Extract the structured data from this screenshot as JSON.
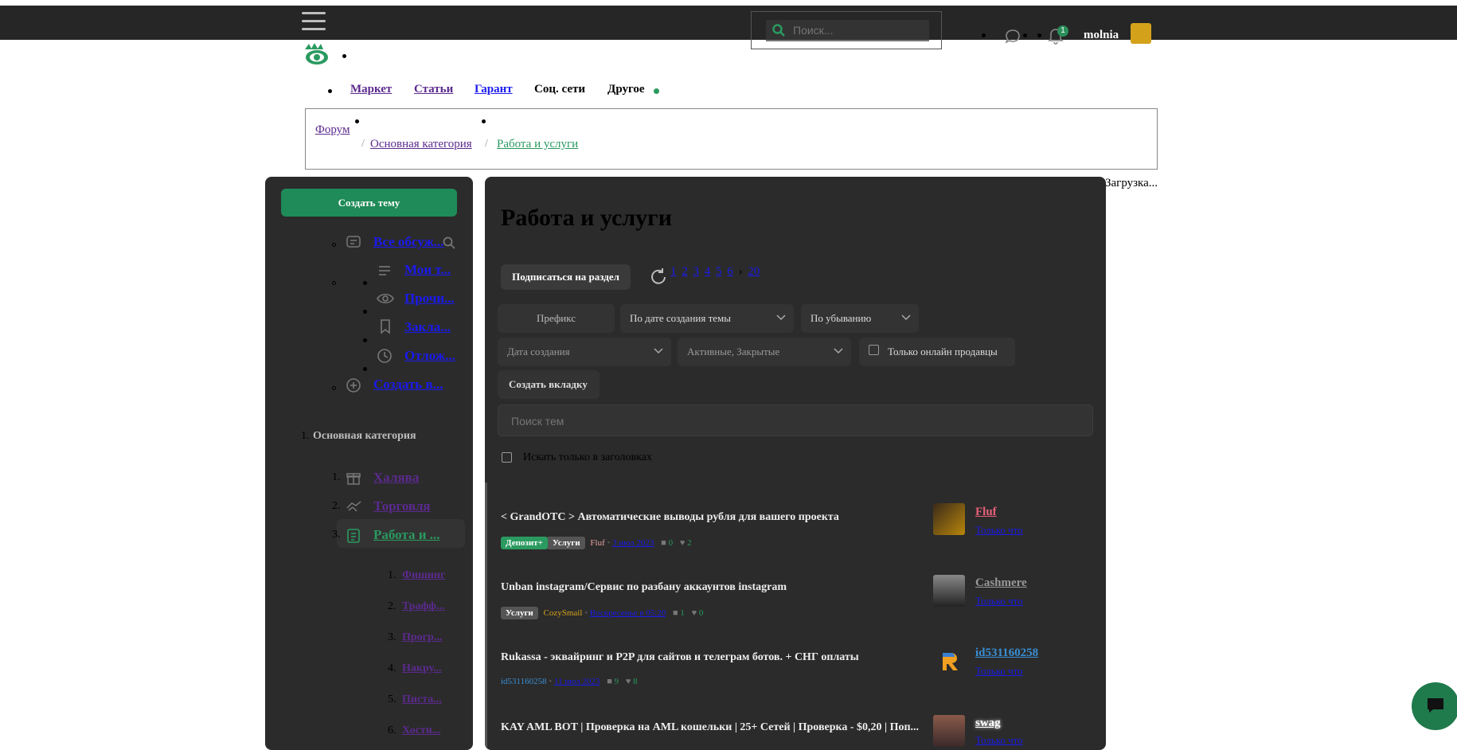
{
  "header": {
    "search_placeholder": "Поиск...",
    "notifications_count": "1",
    "username": "molnia"
  },
  "nav": {
    "items": [
      {
        "label": "Маркет"
      },
      {
        "label": "Статьи"
      },
      {
        "label": "Гарант"
      },
      {
        "label": "Соц. сети"
      },
      {
        "label": "Другое"
      }
    ]
  },
  "breadcrumb": [
    "Форум",
    "Основная категория",
    "Работа и услуги"
  ],
  "loading_text": "Загрузка...",
  "sidebar": {
    "create_button": "Создать тему",
    "links": [
      {
        "label": "Все обсуж..."
      },
      {
        "label": "Мои т..."
      },
      {
        "label": "Прочи..."
      },
      {
        "label": "Закла..."
      },
      {
        "label": "Отлож..."
      },
      {
        "label": "Создать в..."
      }
    ],
    "category_title": "Основная категория",
    "categories": [
      {
        "num": "1.",
        "label": "Халява"
      },
      {
        "num": "2.",
        "label": "Торговля"
      },
      {
        "num": "3.",
        "label": "Работа и ..."
      }
    ],
    "subcategories": [
      {
        "num": "1.",
        "label": "Фишинг"
      },
      {
        "num": "2.",
        "label": "Трафф..."
      },
      {
        "num": "3.",
        "label": "Прогр..."
      },
      {
        "num": "4.",
        "label": "Накру..."
      },
      {
        "num": "5.",
        "label": "Писта..."
      },
      {
        "num": "6.",
        "label": "Хости..."
      }
    ]
  },
  "main": {
    "title": "Работа и услуги",
    "subscribe_button": "Подписаться на раздел",
    "pages": [
      "1",
      "2",
      "3",
      "4",
      "5",
      "6",
      "20"
    ],
    "filters": {
      "prefix": "Префикс",
      "sort": "По дате создания темы",
      "order": "По убыванию",
      "date": "Дата создания",
      "status": "Активные, Закрытые",
      "online_only": "Только онлайн продавцы",
      "create_tab": "Создать вкладку"
    },
    "search_placeholder": "Поиск тем",
    "titles_only": "Искать только в заголовках",
    "threads": [
      {
        "title": "< GrandOTC > Автоматические выводы рубля для вашего проекта",
        "tags": [
          "Депозит+",
          "Услуги"
        ],
        "author_small": "Fluf",
        "date": "3 июл 2023",
        "replies": "0",
        "likes": "2",
        "last_user": "Fluf",
        "last_time": "Только что"
      },
      {
        "title": "Unban instagram/Сервис по разбану аккаунтов instagram",
        "tags": [
          "Услуги"
        ],
        "author_small": "CozySmail",
        "date": "Воскресенье в 05:20",
        "replies": "1",
        "likes": "0",
        "last_user": "Cashmere",
        "last_time": "Только что"
      },
      {
        "title": "Rukassa - эквайринг и P2P для сайтов и телеграм ботов. + СНГ оплаты",
        "tags": [],
        "author_small": "id531160258",
        "date": "11 июл 2023",
        "replies": "9",
        "likes": "8",
        "last_user": "id531160258",
        "last_time": "Только что"
      },
      {
        "title": "KAY AML BOT | Проверка на AML кошельки | 25+ Сетей | Проверка - $0,20 | Поп...",
        "tags": [],
        "author_small": "",
        "date": "",
        "replies": "",
        "likes": "",
        "last_user": "swag",
        "last_time": "Только что"
      }
    ]
  }
}
